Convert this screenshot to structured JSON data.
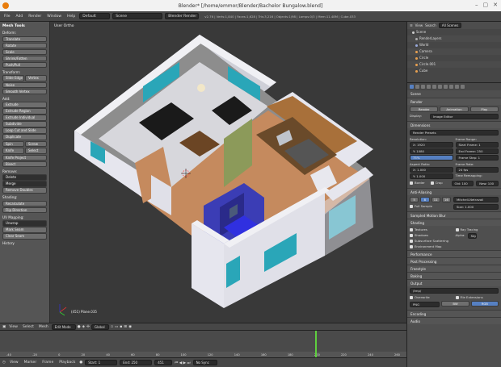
{
  "titlebar": {
    "title": "Blender* [/home/emmor/Blender/Bachelor Bungalow.blend]"
  },
  "infobar": {
    "menus": [
      "File",
      "Add",
      "Render",
      "Window",
      "Help"
    ],
    "layout": "Default",
    "scene": "Scene",
    "engine": "Blender Render",
    "stats": "v2.76 | Verts:1,840 | Faces:1,628 | Tris:3,216 | Objects:1/98 | Lamps:0/3 | Mem:11.48M | Cube.033"
  },
  "toolshelf": {
    "header": "Mesh Tools",
    "sec_deform": "Deform:",
    "deform": [
      "Translate",
      "Rotate",
      "Scale",
      "Shrink/Fatten",
      "Push/Pull"
    ],
    "sec_transform": "Transform:",
    "transform_row": [
      "Slide Edge",
      "Vertex"
    ],
    "transform_more": [
      "Noise",
      "Smooth Vertex"
    ],
    "sec_add": "Add:",
    "add": [
      "Extrude",
      "Extrude Region",
      "Extrude Individual",
      "Subdivide",
      "Loop Cut and Slide",
      "Duplicate"
    ],
    "add_row1": [
      "Spin",
      "Screw"
    ],
    "add_row2": [
      "Knife",
      "Select"
    ],
    "add_more": [
      "Knife Project",
      "Bisect"
    ],
    "sec_remove": "Remove:",
    "remove": [
      "Delete",
      "Merge",
      "Remove Doubles"
    ],
    "sec_shading": "Shading:",
    "shading": [
      "Recalculate",
      "Flip Direction"
    ],
    "sec_uv": "UV Mapping:",
    "uv": [
      "Unwrap",
      "Mark Seam",
      "Clear Seam"
    ],
    "history": "History"
  },
  "viewport": {
    "label": "User Ortho",
    "object": "(451) Plane.035"
  },
  "view_header": {
    "menus": [
      "View",
      "Select",
      "Mesh"
    ],
    "mode": "Edit Mode",
    "pivot": "Global"
  },
  "timeline": {
    "ticks": [
      "-40",
      "-20",
      "0",
      "20",
      "40",
      "60",
      "80",
      "100",
      "120",
      "140",
      "160",
      "180",
      "200",
      "220",
      "240",
      "260"
    ]
  },
  "timebar": {
    "menus": [
      "View",
      "Marker",
      "Frame",
      "Playback"
    ],
    "start": "Start: 1",
    "end": "End: 250",
    "frame": "451",
    "sync": "No Sync"
  },
  "outliner": {
    "menus": [
      "View",
      "Search",
      "All Scenes"
    ],
    "rows": [
      "Scene",
      "RenderLayers",
      "World",
      "Camera",
      "Circle",
      "Circle.001",
      "Cube"
    ]
  },
  "properties": {
    "object": "Scene",
    "render_panel": "Render",
    "render_buttons": [
      "Render",
      "Animation",
      "Play"
    ],
    "display_label": "Display:",
    "display_value": "Image Editor",
    "dimensions_panel": "Dimensions",
    "render_presets": "Render Presets",
    "resolution": "Resolution:",
    "res_x": "X: 1920",
    "res_y": "Y: 1080",
    "res_pct": "75%",
    "frame_range": "Frame Range:",
    "start_frame": "Start Frame: 1",
    "end_frame": "End Frame: 250",
    "frame_step": "Frame Step: 1",
    "aspect": "Aspect Ratio:",
    "aspect_x": "X: 1.000",
    "aspect_y": "Y: 1.000",
    "frame_rate": "Frame Rate:",
    "fps": "24 fps",
    "time_remap": "Time Remapping:",
    "remap_old": "Old: 100",
    "remap_new": "New: 100",
    "border": "Border",
    "crop": "Crop",
    "aa_panel": "Anti-Aliasing",
    "aa_samples": [
      "5",
      "8",
      "11",
      "16"
    ],
    "aa_filter": "Mitchell-Netravali",
    "full_sample": "Full Sample",
    "aa_size": "Size: 1.000",
    "motion_blur": "Sampled Motion Blur",
    "shading_panel": "Shading",
    "textures": "Textures",
    "ray_tracing": "Ray Tracing",
    "shadows": "Shadows",
    "alpha_label": "Alpha:",
    "alpha_value": "Sky",
    "sss": "Subsurface Scattering",
    "env_map": "Environment Map",
    "performance": "Performance",
    "post_processing": "Post Processing",
    "freestyle": "Freestyle",
    "baking": "Baking",
    "output_panel": "Output",
    "output_path": "/tmp/",
    "overwrite": "Overwrite",
    "file_ext": "File Extensions",
    "format": "PNG",
    "bw": "BW",
    "rgb": "RGB",
    "encoding": "Encoding",
    "audio": "Audio"
  },
  "colors": {
    "accent": "#5680c2",
    "timeline_cursor": "#5fcf3f",
    "app_icon": "#e87d0d"
  }
}
